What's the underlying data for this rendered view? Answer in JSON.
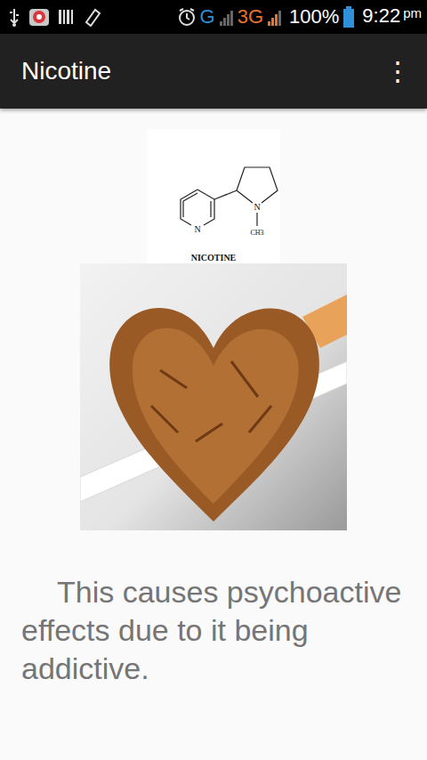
{
  "status_bar": {
    "network_primary": "G",
    "network_secondary": "3G",
    "battery": "100%",
    "time": "9:22",
    "time_suffix": "pm"
  },
  "app_bar": {
    "title": "Nicotine",
    "menu": "⋮"
  },
  "structure": {
    "ring_n": "N",
    "amine_n": "N",
    "methyl": "CH3",
    "caption": "NICOTINE"
  },
  "body": {
    "text": "This causes psychoactive effects due to it being addictive."
  }
}
